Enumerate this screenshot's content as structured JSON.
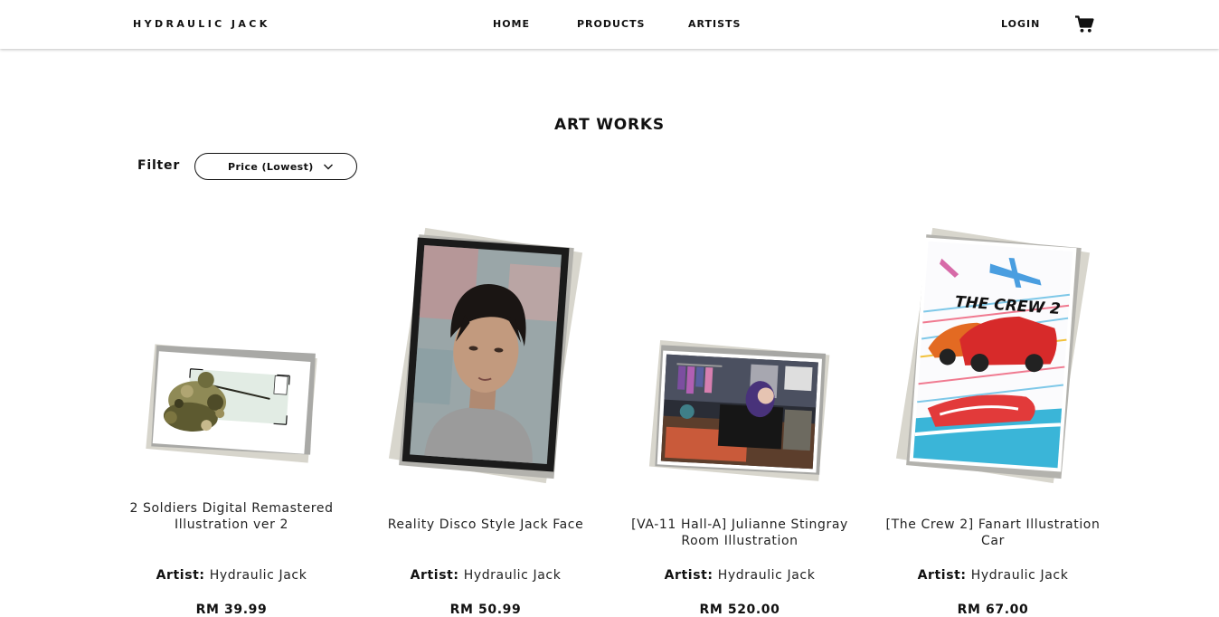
{
  "nav": {
    "brand": "HYDRAULIC JACK",
    "links": [
      "HOME",
      "PRODUCTS",
      "ARTISTS"
    ],
    "login": "LOGIN",
    "cart_icon": "shopping-cart-icon"
  },
  "page": {
    "title": "ART WORKS",
    "filter_label": "Filter",
    "filter_value": "Price (Lowest)"
  },
  "products": [
    {
      "title": "2 Soldiers Digital Remastered Illustration ver 2",
      "artist_label": "Artist:",
      "artist": "Hydraulic Jack",
      "price": "RM 39.99"
    },
    {
      "title": "Reality Disco Style Jack Face",
      "artist_label": "Artist:",
      "artist": "Hydraulic Jack",
      "price": "RM 50.99"
    },
    {
      "title": "[VA-11 Hall-A] Julianne Stingray Room Illustration",
      "artist_label": "Artist:",
      "artist": "Hydraulic Jack",
      "price": "RM 520.00"
    },
    {
      "title": "[The Crew 2] Fanart Illustration Car",
      "artist_label": "Artist:",
      "artist": "Hydraulic Jack",
      "price": "RM 67.00"
    }
  ],
  "artwork_logo_text": "THE CREW 2"
}
